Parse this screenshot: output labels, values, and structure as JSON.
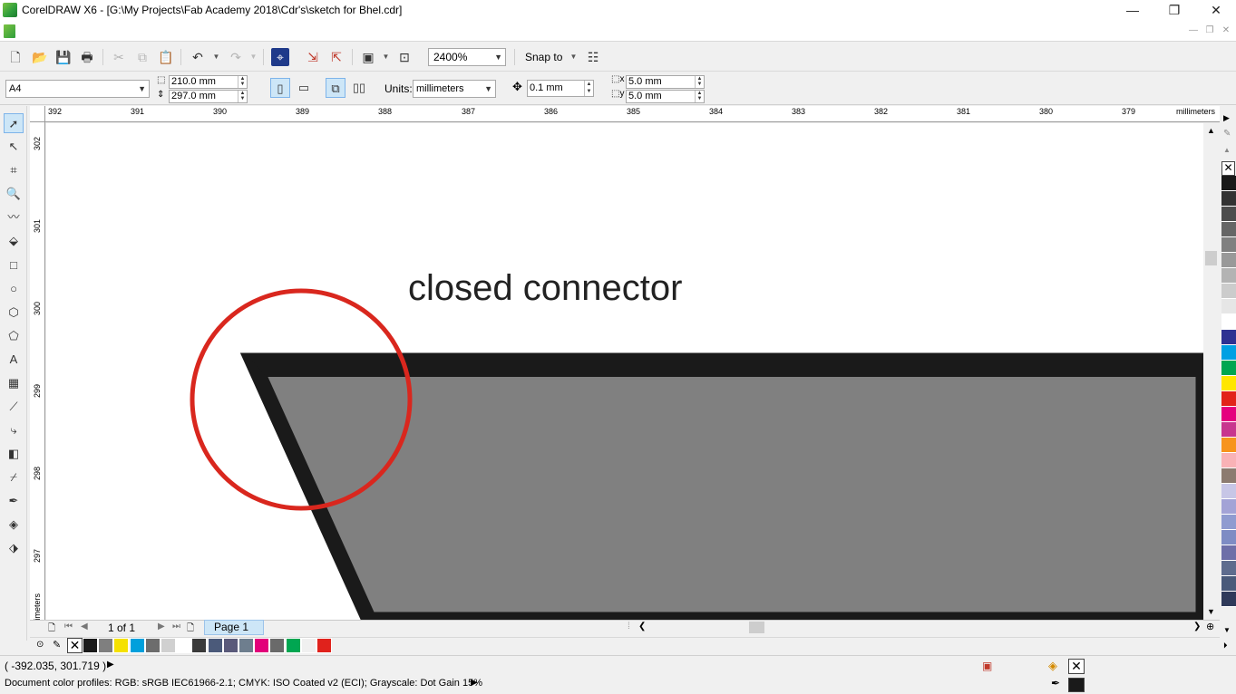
{
  "window": {
    "title": "CorelDRAW X6 - [G:\\My Projects\\Fab Academy 2018\\Cdr's\\sketch for  Bhel.cdr]",
    "minimize_glyph": "—",
    "restore_glyph": "❐",
    "close_glyph": "✕"
  },
  "toolbar": {
    "zoom_value": "2400%",
    "snap_label": "Snap to"
  },
  "propbar": {
    "paper_size": "A4",
    "width": "210.0 mm",
    "height": "297.0 mm",
    "units_label": "Units:",
    "units_value": "millimeters",
    "nudge": "0.1 mm",
    "dup_x": "5.0 mm",
    "dup_y": "5.0 mm"
  },
  "rulers": {
    "h_ticks": [
      "392",
      "391",
      "390",
      "389",
      "388",
      "387",
      "386",
      "385",
      "384",
      "383",
      "382",
      "381",
      "380",
      "379"
    ],
    "h_unit": "millimeters",
    "v_ticks": [
      "302",
      "301",
      "300",
      "299",
      "298",
      "297"
    ],
    "v_unit": "millimeters"
  },
  "canvas": {
    "annotation": "closed connector",
    "shape_fill": "#808080",
    "shape_outline": "#1a1a1a",
    "circle_color": "#d9271e"
  },
  "page_nav": {
    "page_count": "1 of 1",
    "page_tab": "Page 1"
  },
  "doc_palette": [
    "#1a1a1a",
    "#7f7f7f",
    "#f5e100",
    "#00a0dc",
    "#6d6d6d",
    "#d0d0d0",
    "#ffffff",
    "#3a3a3a",
    "#4b5a7a",
    "#5a5a7a",
    "#6e7e8e",
    "#e2007a",
    "#6a6a6a",
    "#00a651",
    "#f0f0f0",
    "#e0221c"
  ],
  "right_palette": [
    "#1a1a1a",
    "#333333",
    "#4d4d4d",
    "#666666",
    "#808080",
    "#999999",
    "#b3b3b3",
    "#cccccc",
    "#e6e6e6",
    "#ffffff",
    "#2e3192",
    "#00a0e3",
    "#00a651",
    "#ffe600",
    "#e2231a",
    "#e5007e",
    "#c8368e",
    "#f7941d",
    "#f9b2b6",
    "#8c7b70",
    "#c7c6e6",
    "#a3a3d6",
    "#8f9bd0",
    "#7e8cc4",
    "#6e6fa8",
    "#5e6c8e",
    "#4a5a7a",
    "#2f3a5a"
  ],
  "status": {
    "coords": "( -392.035, 301.719 )",
    "color_profiles": "Document color profiles: RGB: sRGB IEC61966-2.1; CMYK: ISO Coated v2 (ECI); Grayscale: Dot Gain 15%",
    "fill_color": "#1a1a1a",
    "outline_none": "✕"
  }
}
